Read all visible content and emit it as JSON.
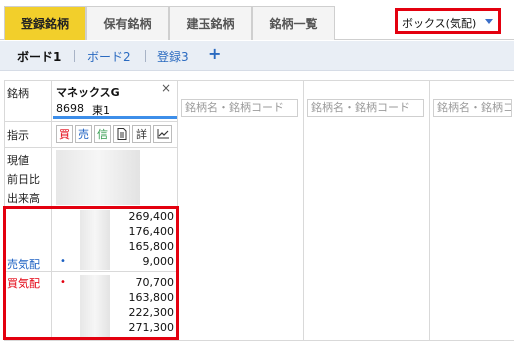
{
  "tabs": [
    "登録銘柄",
    "保有銘柄",
    "建玉銘柄",
    "銘柄一覧"
  ],
  "dropdown": {
    "value": "ボックス(気配)"
  },
  "boards": {
    "items": [
      "ボード1",
      "ボード2",
      "登録3"
    ],
    "plus": "+"
  },
  "rows": {
    "stock": "銘柄",
    "order": "指示",
    "price": "現値",
    "change": "前日比",
    "volume": "出来高",
    "sell_quote": "売気配",
    "buy_quote": "買気配"
  },
  "stock": {
    "name": "マネックスG",
    "code": "8698",
    "market": "東1",
    "close": "×"
  },
  "placeholder": "銘柄名・銘柄コード",
  "buttons": {
    "buy": "買",
    "sell": "売",
    "credit": "信",
    "info": "詳"
  },
  "sell_quotes": [
    "269,400",
    "176,400",
    "165,800",
    "9,000"
  ],
  "buy_quotes": [
    "70,700",
    "163,800",
    "222,300",
    "271,300"
  ],
  "dot": "•"
}
